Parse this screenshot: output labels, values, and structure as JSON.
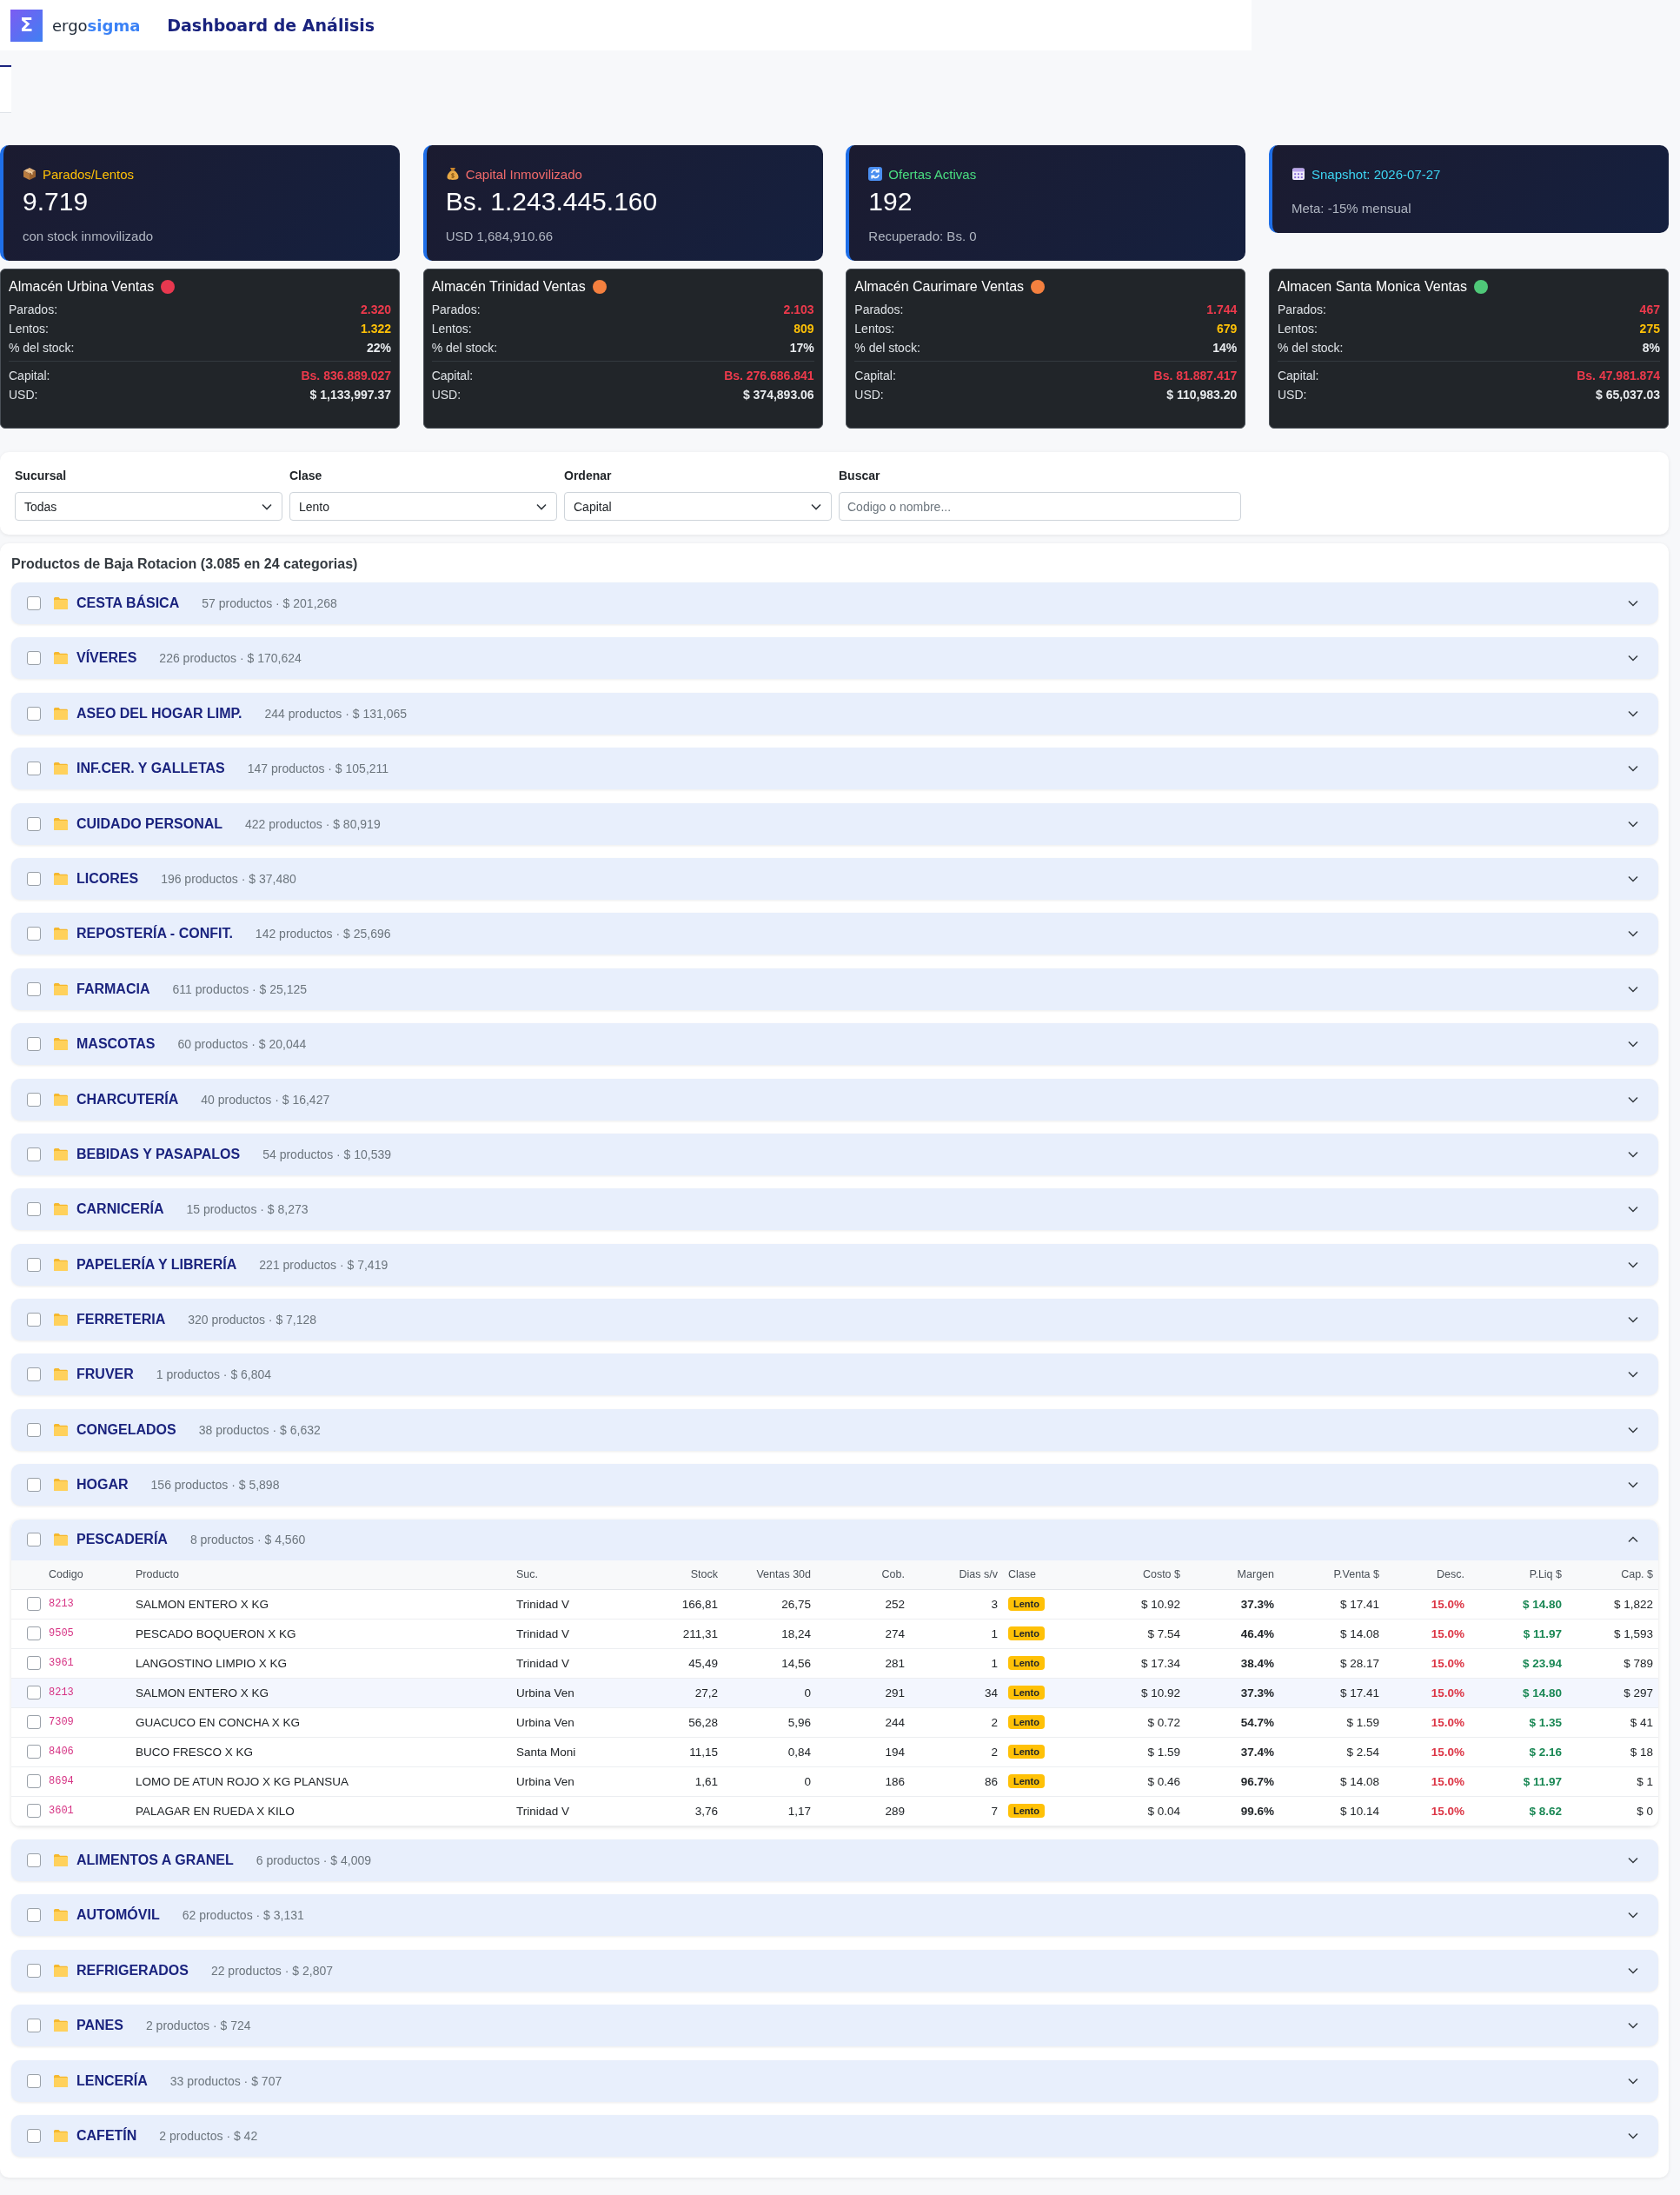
{
  "header": {
    "logo_mark": "Σ",
    "brand": "ergo**sigma**",
    "title": "Dashboard de Análisis"
  },
  "kpis": [
    {
      "kind": "stock",
      "label": "Parados/Lentos",
      "value": "9.719",
      "note": "con stock inmovilizado"
    },
    {
      "kind": "capital",
      "label": "Capital Inmovilizado",
      "value": "Bs. 1.243.445.160",
      "note": "USD 1,684,910.66"
    },
    {
      "kind": "offers",
      "label": "Ofertas Activas",
      "value": "192",
      "note": "Recuperado: Bs. 0"
    },
    {
      "kind": "snapshot",
      "label": "Snapshot: 2026-07-27",
      "note": "Meta: -15% mensual"
    }
  ],
  "branches": [
    {
      "name": "Almacén Urbina Ventas",
      "color": "#e8384f",
      "stats": [
        {
          "kind": "parados",
          "label": "Parados:",
          "value": "2.320"
        },
        {
          "kind": "lentos",
          "label": "Lentos:",
          "value": "1.322"
        },
        {
          "kind": "share",
          "label": "% del stock:",
          "value": "22%"
        }
      ],
      "money": [
        {
          "kind": "capital",
          "label": "Capital:",
          "value": "Bs. 836.889.027"
        },
        {
          "kind": "usd",
          "label": "USD:",
          "value": "$ 1,133,997.37"
        }
      ]
    },
    {
      "name": "Almacén Trinidad Ventas",
      "color": "#f4803f",
      "stats": [
        {
          "kind": "parados",
          "label": "Parados:",
          "value": "2.103"
        },
        {
          "kind": "lentos",
          "label": "Lentos:",
          "value": "809"
        },
        {
          "kind": "share",
          "label": "% del stock:",
          "value": "17%"
        }
      ],
      "money": [
        {
          "kind": "capital",
          "label": "Capital:",
          "value": "Bs. 276.686.841"
        },
        {
          "kind": "usd",
          "label": "USD:",
          "value": "$ 374,893.06"
        }
      ]
    },
    {
      "name": "Almacén Caurimare Ventas",
      "color": "#f4803f",
      "stats": [
        {
          "kind": "parados",
          "label": "Parados:",
          "value": "1.744"
        },
        {
          "kind": "lentos",
          "label": "Lentos:",
          "value": "679"
        },
        {
          "kind": "share",
          "label": "% del stock:",
          "value": "14%"
        }
      ],
      "money": [
        {
          "kind": "capital",
          "label": "Capital:",
          "value": "Bs. 81.887.417"
        },
        {
          "kind": "usd",
          "label": "USD:",
          "value": "$ 110,983.20"
        }
      ]
    },
    {
      "name": "Almacen Santa Monica Ventas",
      "color": "#4fc878",
      "stats": [
        {
          "kind": "parados",
          "label": "Parados:",
          "value": "467"
        },
        {
          "kind": "lentos",
          "label": "Lentos:",
          "value": "275"
        },
        {
          "kind": "share",
          "label": "% del stock:",
          "value": "8%"
        }
      ],
      "money": [
        {
          "kind": "capital",
          "label": "Capital:",
          "value": "Bs. 47.981.874"
        },
        {
          "kind": "usd",
          "label": "USD:",
          "value": "$ 65,037.03"
        }
      ]
    }
  ],
  "filters": [
    {
      "kind": "select",
      "label": "Sucursal",
      "value": "Todas"
    },
    {
      "kind": "select",
      "label": "Clase",
      "value": "Lento"
    },
    {
      "kind": "select",
      "label": "Ordenar",
      "value": "Capital"
    },
    {
      "kind": "search",
      "label": "Buscar",
      "placeholder": "Codigo o nombre..."
    }
  ],
  "list": {
    "title": "Productos de Baja Rotacion (3.085 en 24 categorias)",
    "categories": [
      {
        "name": "CESTA BÁSICA",
        "meta": "57 productos · $ 201,268",
        "checked": false,
        "expanded": false
      },
      {
        "name": "VÍVERES",
        "meta": "226 productos · $ 170,624",
        "checked": false,
        "expanded": false
      },
      {
        "name": "ASEO DEL HOGAR LIMP.",
        "meta": "244 productos · $ 131,065",
        "checked": false,
        "expanded": false
      },
      {
        "name": "INF.CER. Y GALLETAS",
        "meta": "147 productos · $ 105,211",
        "checked": false,
        "expanded": false
      },
      {
        "name": "CUIDADO PERSONAL",
        "meta": "422 productos · $ 80,919",
        "checked": false,
        "expanded": false
      },
      {
        "name": "LICORES",
        "meta": "196 productos · $ 37,480",
        "checked": false,
        "expanded": false
      },
      {
        "name": "REPOSTERÍA - CONFIT.",
        "meta": "142 productos · $ 25,696",
        "checked": false,
        "expanded": false
      },
      {
        "name": "FARMACIA",
        "meta": "611 productos · $ 25,125",
        "checked": false,
        "expanded": false
      },
      {
        "name": "MASCOTAS",
        "meta": "60 productos · $ 20,044",
        "checked": false,
        "expanded": false
      },
      {
        "name": "CHARCUTERÍA",
        "meta": "40 productos · $ 16,427",
        "checked": false,
        "expanded": false
      },
      {
        "name": "BEBIDAS Y PASAPALOS",
        "meta": "54 productos · $ 10,539",
        "checked": false,
        "expanded": false
      },
      {
        "name": "CARNICERÍA",
        "meta": "15 productos · $ 8,273",
        "checked": false,
        "expanded": false
      },
      {
        "name": "PAPELERÍA Y LIBRERÍA",
        "meta": "221 productos · $ 7,419",
        "checked": false,
        "expanded": false
      },
      {
        "name": "FERRETERIA",
        "meta": "320 productos · $ 7,128",
        "checked": false,
        "expanded": false
      },
      {
        "name": "FRUVER",
        "meta": "1 productos · $ 6,804",
        "checked": false,
        "expanded": false
      },
      {
        "name": "CONGELADOS",
        "meta": "38 productos · $ 6,632",
        "checked": false,
        "expanded": false
      },
      {
        "name": "HOGAR",
        "meta": "156 productos · $ 5,898",
        "checked": false,
        "expanded": false
      },
      {
        "name": "PESCADERÍA",
        "meta": "8 productos · $ 4,560",
        "checked": false,
        "expanded": true,
        "table": {
          "columns": [
            {
              "label": "Codigo",
              "kind": "code"
            },
            {
              "label": "Producto",
              "kind": "text"
            },
            {
              "label": "Suc.",
              "kind": "text"
            },
            {
              "label": "Stock",
              "kind": "number"
            },
            {
              "label": "Ventas 30d",
              "kind": "number"
            },
            {
              "label": "Cob.",
              "kind": "number"
            },
            {
              "label": "Dias s/v",
              "kind": "number"
            },
            {
              "label": "Clase",
              "kind": "badge"
            },
            {
              "label": "Costo $",
              "kind": "number"
            },
            {
              "label": "Margen",
              "kind": "strong"
            },
            {
              "label": "P.Venta $",
              "kind": "number"
            },
            {
              "label": "Desc.",
              "kind": "discount"
            },
            {
              "label": "P.Liq $",
              "kind": "net"
            },
            {
              "label": "Cap. $",
              "kind": "number"
            }
          ],
          "rows": [
            {
              "checked": false,
              "hovered": false,
              "cells": [
                "8213",
                "SALMON ENTERO X KG",
                "Trinidad V",
                "166,81",
                "26,75",
                "252",
                "3",
                "Lento",
                "$ 10.92",
                "37.3%",
                "$ 17.41",
                "15.0%",
                "$ 14.80",
                "$ 1,822"
              ]
            },
            {
              "checked": false,
              "hovered": false,
              "cells": [
                "9505",
                "PESCADO BOQUERON X KG",
                "Trinidad V",
                "211,31",
                "18,24",
                "274",
                "1",
                "Lento",
                "$ 7.54",
                "46.4%",
                "$ 14.08",
                "15.0%",
                "$ 11.97",
                "$ 1,593"
              ]
            },
            {
              "checked": false,
              "hovered": false,
              "cells": [
                "3961",
                "LANGOSTINO LIMPIO X KG",
                "Trinidad V",
                "45,49",
                "14,56",
                "281",
                "1",
                "Lento",
                "$ 17.34",
                "38.4%",
                "$ 28.17",
                "15.0%",
                "$ 23.94",
                "$ 789"
              ]
            },
            {
              "checked": false,
              "hovered": true,
              "cells": [
                "8213",
                "SALMON ENTERO X KG",
                "Urbina Ven",
                "27,2",
                "0",
                "291",
                "34",
                "Lento",
                "$ 10.92",
                "37.3%",
                "$ 17.41",
                "15.0%",
                "$ 14.80",
                "$ 297"
              ]
            },
            {
              "checked": false,
              "hovered": false,
              "cells": [
                "7309",
                "GUACUCO EN CONCHA X KG",
                "Urbina Ven",
                "56,28",
                "5,96",
                "244",
                "2",
                "Lento",
                "$ 0.72",
                "54.7%",
                "$ 1.59",
                "15.0%",
                "$ 1.35",
                "$ 41"
              ]
            },
            {
              "checked": false,
              "hovered": false,
              "cells": [
                "8406",
                "BUCO FRESCO X KG",
                "Santa Moni",
                "11,15",
                "0,84",
                "194",
                "2",
                "Lento",
                "$ 1.59",
                "37.4%",
                "$ 2.54",
                "15.0%",
                "$ 2.16",
                "$ 18"
              ]
            },
            {
              "checked": false,
              "hovered": false,
              "cells": [
                "8694",
                "LOMO DE ATUN ROJO X KG PLANSUA",
                "Urbina Ven",
                "1,61",
                "0",
                "186",
                "86",
                "Lento",
                "$ 0.46",
                "96.7%",
                "$ 14.08",
                "15.0%",
                "$ 11.97",
                "$ 1"
              ]
            },
            {
              "checked": false,
              "hovered": false,
              "cells": [
                "3601",
                "PALAGAR EN RUEDA X KILO",
                "Trinidad V",
                "3,76",
                "1,17",
                "289",
                "7",
                "Lento",
                "$ 0.04",
                "99.6%",
                "$ 10.14",
                "15.0%",
                "$ 8.62",
                "$ 0"
              ]
            }
          ]
        }
      },
      {
        "name": "ALIMENTOS A GRANEL",
        "meta": "6 productos · $ 4,009",
        "checked": false,
        "expanded": false
      },
      {
        "name": "AUTOMÓVIL",
        "meta": "62 productos · $ 3,131",
        "checked": false,
        "expanded": false
      },
      {
        "name": "REFRIGERADOS",
        "meta": "22 productos · $ 2,807",
        "checked": false,
        "expanded": false
      },
      {
        "name": "PANES",
        "meta": "2 productos · $ 724",
        "checked": false,
        "expanded": false
      },
      {
        "name": "LENCERÍA",
        "meta": "33 productos · $ 707",
        "checked": false,
        "expanded": false
      },
      {
        "name": "CAFETÍN",
        "meta": "2 productos · $ 42",
        "checked": false,
        "expanded": false
      }
    ]
  }
}
